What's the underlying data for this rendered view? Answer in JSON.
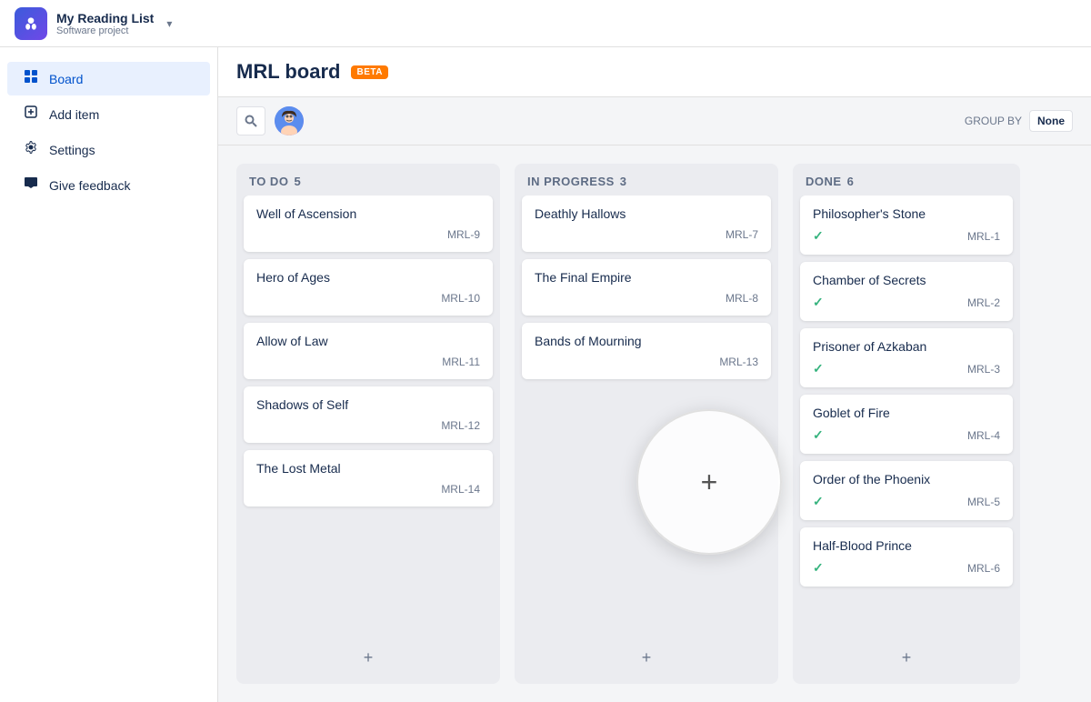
{
  "header": {
    "logo_char": "🦊",
    "project_name": "My Reading List",
    "project_type": "Software project"
  },
  "sidebar": {
    "items": [
      {
        "id": "board",
        "label": "Board",
        "icon": "▦",
        "active": true
      },
      {
        "id": "add-item",
        "label": "Add item",
        "icon": "＋"
      },
      {
        "id": "settings",
        "label": "Settings",
        "icon": "⚙"
      },
      {
        "id": "give-feedback",
        "label": "Give feedback",
        "icon": "📣"
      }
    ]
  },
  "board": {
    "title": "MRL board",
    "beta_label": "BETA",
    "group_by_label": "GROUP BY",
    "group_by_value": "None"
  },
  "toolbar": {
    "search_placeholder": "Search"
  },
  "columns": [
    {
      "id": "todo",
      "title": "TO DO",
      "count": 5,
      "cards": [
        {
          "title": "Well of Ascension",
          "id": "MRL-9"
        },
        {
          "title": "Hero of Ages",
          "id": "MRL-10"
        },
        {
          "title": "Allow of Law",
          "id": "MRL-11"
        },
        {
          "title": "Shadows of Self",
          "id": "MRL-12"
        },
        {
          "title": "The Lost Metal",
          "id": "MRL-14"
        }
      ]
    },
    {
      "id": "in-progress",
      "title": "IN PROGRESS",
      "count": 3,
      "cards": [
        {
          "title": "Deathly Hallows",
          "id": "MRL-7"
        },
        {
          "title": "The Final Empire",
          "id": "MRL-8"
        },
        {
          "title": "Bands of Mourning",
          "id": "MRL-13"
        }
      ]
    },
    {
      "id": "done",
      "title": "DONE",
      "count": 6,
      "cards": [
        {
          "title": "Philosopher's Stone",
          "id": "MRL-1",
          "done": true
        },
        {
          "title": "Chamber of Secrets",
          "id": "MRL-2",
          "done": true
        },
        {
          "title": "Prisoner of Azkaban",
          "id": "MRL-3",
          "done": true
        },
        {
          "title": "Goblet of Fire",
          "id": "MRL-4",
          "done": true
        },
        {
          "title": "Order of the Phoenix",
          "id": "MRL-5",
          "done": true
        },
        {
          "title": "Half-Blood Prince",
          "id": "MRL-6",
          "done": true
        }
      ]
    }
  ]
}
